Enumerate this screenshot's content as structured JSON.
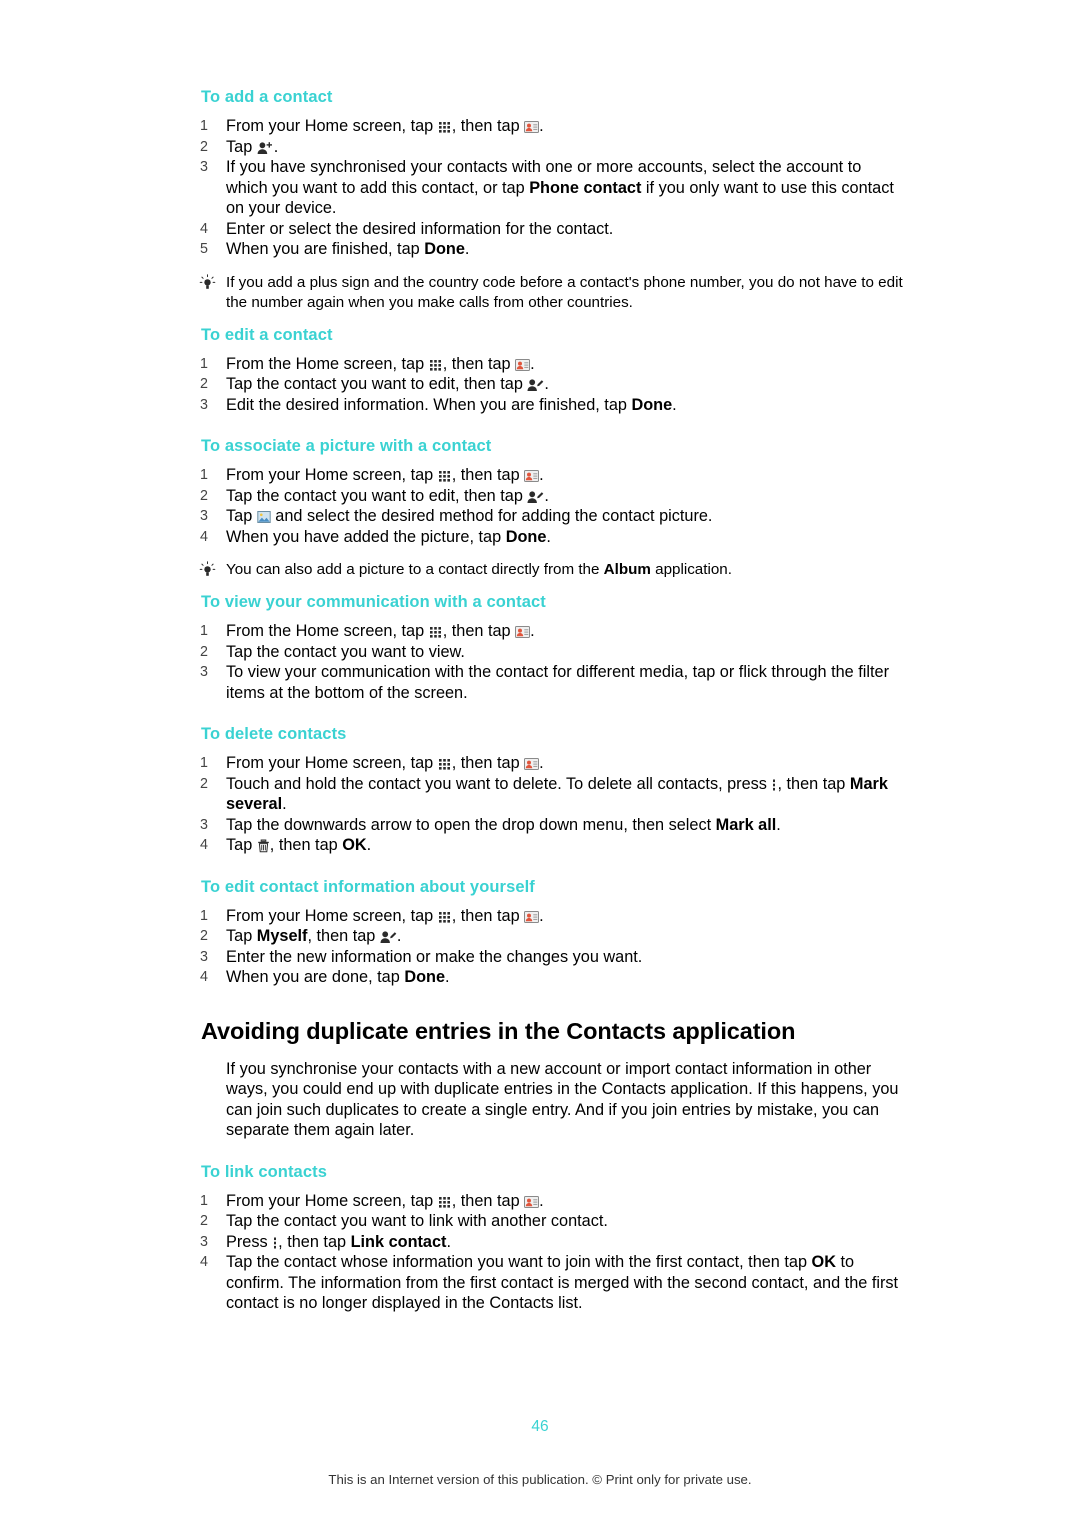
{
  "page": {
    "number": "46",
    "footer": "This is an Internet version of this publication. © Print only for private use."
  },
  "sections": [
    {
      "heading": "To add a contact",
      "steps": [
        "From your Home screen, tap ⟦apps⟧, then tap ⟦contacts⟧.",
        "Tap ⟦addcontact⟧.",
        "If you have synchronised your contacts with one or more accounts, select the account to which you want to add this contact, or tap Phone contact if you only want to use this contact on your device.",
        "Enter or select the desired information for the contact.",
        "When you are finished, tap Done."
      ],
      "tip": "If you add a plus sign and the country code before a contact's phone number, you do not have to edit the number again when you make calls from other countries."
    },
    {
      "heading": "To edit a contact",
      "steps": [
        "From the Home screen, tap ⟦apps⟧, then tap ⟦contacts⟧.",
        "Tap the contact you want to edit, then tap ⟦editcontact⟧.",
        "Edit the desired information. When you are finished, tap Done."
      ]
    },
    {
      "heading": "To associate a picture with a contact",
      "steps": [
        "From your Home screen, tap ⟦apps⟧, then tap ⟦contacts⟧.",
        "Tap the contact you want to edit, then tap ⟦editcontact⟧.",
        "Tap ⟦picture⟧ and select the desired method for adding the contact picture.",
        "When you have added the picture, tap Done."
      ],
      "tip": "You can also add a picture to a contact directly from the Album application."
    },
    {
      "heading": "To view your communication with a contact",
      "steps": [
        "From the Home screen, tap ⟦apps⟧, then tap ⟦contacts⟧.",
        "Tap the contact you want to view.",
        "To view your communication with the contact for different media, tap or flick through the filter items at the bottom of the screen."
      ]
    },
    {
      "heading": "To delete contacts",
      "steps": [
        "From your Home screen, tap ⟦apps⟧, then tap ⟦contacts⟧.",
        "Touch and hold the contact you want to delete. To delete all contacts, press ⟦menu⟧, then tap Mark several.",
        "Tap the downwards arrow to open the drop down menu, then select Mark all.",
        "Tap ⟦trash⟧, then tap OK."
      ]
    },
    {
      "heading": "To edit contact information about yourself",
      "steps": [
        "From your Home screen, tap ⟦apps⟧, then tap ⟦contacts⟧.",
        "Tap Myself, then tap ⟦editcontact⟧.",
        "Enter the new information or make the changes you want.",
        "When you are done, tap Done."
      ]
    }
  ],
  "chapter": {
    "title": "Avoiding duplicate entries in the Contacts application",
    "body": "If you synchronise your contacts with a new account or import contact information in other ways, you could end up with duplicate entries in the Contacts application. If this happens, you can join such duplicates to create a single entry. And if you join entries by mistake, you can separate them again later.",
    "section": {
      "heading": "To link contacts",
      "steps": [
        "From your Home screen, tap ⟦apps⟧, then tap ⟦contacts⟧.",
        "Tap the contact you want to link with another contact.",
        "Press ⟦menu⟧, then tap Link contact.",
        "Tap the contact whose information you want to join with the first contact, then tap OK to confirm. The information from the first contact is merged with the second contact, and the first contact is no longer displayed in the Contacts list."
      ]
    }
  },
  "colors": {
    "heading_accent": "#3ad2d2",
    "text": "#000000"
  },
  "icons": {
    "apps": "apps-grid-icon",
    "contacts": "contacts-icon",
    "addcontact": "add-contact-icon",
    "editcontact": "edit-contact-icon",
    "picture": "picture-icon",
    "menu": "menu-dots-icon",
    "trash": "trash-icon",
    "bulb": "lightbulb-tip-icon"
  }
}
